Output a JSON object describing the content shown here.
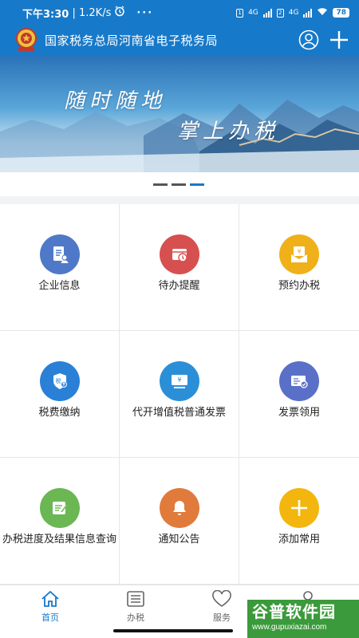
{
  "status_bar": {
    "time": "下午3:30",
    "network_speed": "1.2K/s",
    "more": "···",
    "sim1_label": "4G",
    "sim2_label": "4G",
    "battery": "78"
  },
  "header": {
    "title": "国家税务总局河南省电子税务局"
  },
  "banner": {
    "line1": "随时随地",
    "line2": "掌上办税",
    "slide_count": 3,
    "active_slide": 3
  },
  "features": [
    {
      "label": "企业信息",
      "icon": "company-info-icon",
      "color": "#4f79c8"
    },
    {
      "label": "待办提醒",
      "icon": "clock-reminder-icon",
      "color": "#d6504f"
    },
    {
      "label": "预约办税",
      "icon": "appointment-icon",
      "color": "#f0b019"
    },
    {
      "label": "税费缴纳",
      "icon": "tax-payment-icon",
      "color": "#2a80d6"
    },
    {
      "label": "代开增值税普通发票",
      "icon": "invoice-issue-icon",
      "color": "#2b8fd8"
    },
    {
      "label": "发票领用",
      "icon": "invoice-collect-icon",
      "color": "#5a70c8"
    },
    {
      "label": "办税进度及结果信息查询",
      "icon": "progress-query-icon",
      "color": "#6bb754"
    },
    {
      "label": "通知公告",
      "icon": "notice-bell-icon",
      "color": "#e07b3c"
    },
    {
      "label": "添加常用",
      "icon": "add-icon",
      "color": "#f3b60f"
    }
  ],
  "tabs": [
    {
      "label": "首页",
      "icon": "home-icon",
      "active": true
    },
    {
      "label": "办税",
      "icon": "list-icon",
      "active": false
    },
    {
      "label": "服务",
      "icon": "heart-icon",
      "active": false
    },
    {
      "label": "",
      "icon": "profile-icon",
      "active": false
    }
  ],
  "watermark": {
    "line1": "谷普软件园",
    "line2": "www.gupuxiazai.com"
  },
  "colors": {
    "primary": "#1779c9",
    "background": "#f2f3f5"
  }
}
